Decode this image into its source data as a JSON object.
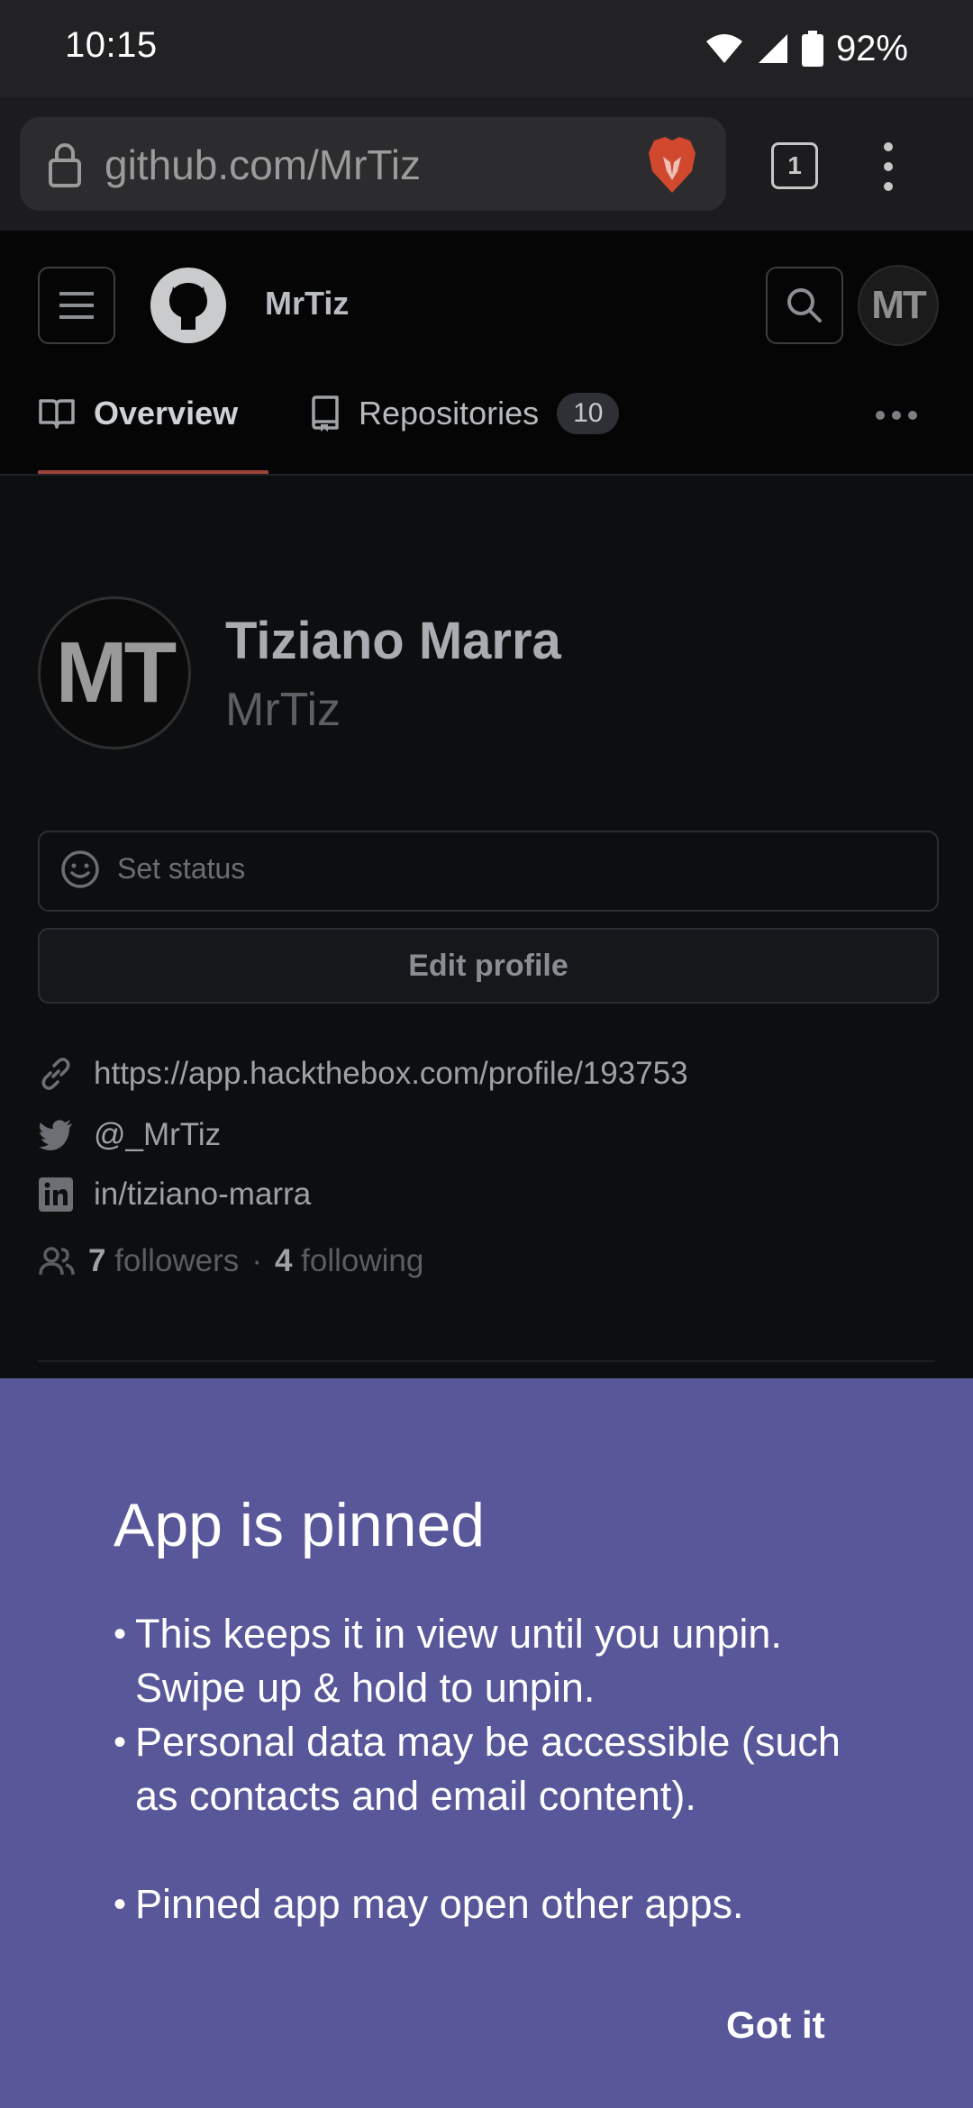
{
  "status_bar": {
    "time": "10:15",
    "battery": "92%"
  },
  "browser": {
    "url": "github.com/MrTiz",
    "tab_count": "1"
  },
  "github": {
    "header_user": "MrTiz",
    "avatar_initials": "MT",
    "tabs": [
      {
        "label": "Overview",
        "active": true
      },
      {
        "label": "Repositories",
        "count": "10",
        "active": false
      }
    ],
    "accent_color": "#a0413a"
  },
  "profile": {
    "name": "Tiziano Marra",
    "login": "MrTiz",
    "status_placeholder": "Set status",
    "edit_label": "Edit profile",
    "website": "https://app.hackthebox.com/profile/193753",
    "twitter": "@_MrTiz",
    "linkedin": "in/tiziano-marra",
    "followers_count": "7",
    "followers_label": "followers",
    "separator": "·",
    "following_count": "4",
    "following_label": "following"
  },
  "pinned_dialog": {
    "background": "#575799",
    "title": "App is pinned",
    "bullets": [
      "This keeps it in view until you unpin. Swipe up & hold to unpin.",
      "Personal data may be accessible (such as contacts and email content).",
      "Pinned app may open other apps."
    ],
    "confirm_label": "Got it"
  }
}
